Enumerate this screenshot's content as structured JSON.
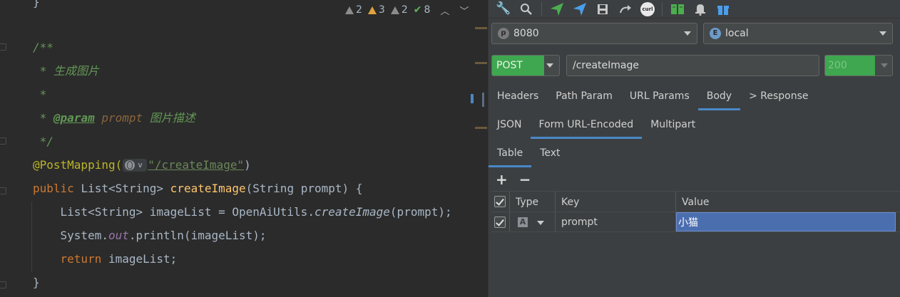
{
  "editor": {
    "inspections": {
      "warning1_count": "2",
      "warning2_count": "3",
      "warning3_count": "2",
      "ok_count": "8"
    },
    "lines": {
      "l0": "}",
      "l1_open": "/**",
      "l2": " * 生成图片",
      "l3": " *",
      "l4_star": " * ",
      "l4_tag": "@param",
      "l4_name": " prompt ",
      "l4_desc": "图片描述",
      "l5": " */",
      "l6_ann": "@PostMapping(",
      "l6_str": "\"/createImage\"",
      "l6_close": ")",
      "l7_kw": "public ",
      "l7_type": "List<String> ",
      "l7_fn": "createImage",
      "l7_rest": "(String prompt) {",
      "l8_a": "    List<String> imageList = OpenAiUtils.",
      "l8_b": "createImage",
      "l8_c": "(prompt);",
      "l9_a": "    System.",
      "l9_b": "out",
      "l9_c": ".println(imageList);",
      "l10_kw": "    return ",
      "l10_rest": "imageList;",
      "l11": "}"
    }
  },
  "http_client": {
    "toolbar_icons": [
      "wrench-icon",
      "search-icon",
      "send-icon",
      "send-blue-icon",
      "save-icon",
      "redo-icon",
      "curl-icon",
      "book-icon",
      "bell-icon",
      "gift-icon"
    ],
    "curl_label": "curl",
    "port_badge": "p",
    "port": "8080",
    "env_badge": "E",
    "env": "local",
    "method": "POST",
    "url": "/createImage",
    "status": "200",
    "tabs_main": [
      "Headers",
      "Path Param",
      "URL Params",
      "Body",
      "> Response"
    ],
    "tabs_body": [
      "JSON",
      "Form URL-Encoded",
      "Multipart"
    ],
    "tabs_form": [
      "Table",
      "Text"
    ],
    "add_label": "+",
    "remove_label": "−",
    "grid": {
      "headers": [
        "Type",
        "Key",
        "Value"
      ],
      "rows": [
        {
          "type": "A",
          "key": "prompt",
          "value": "小猫"
        }
      ]
    },
    "colors": {
      "accent": "#4a88c7",
      "method_bg": "#3ea74f",
      "selected_cell": "#4b6eaf"
    }
  }
}
